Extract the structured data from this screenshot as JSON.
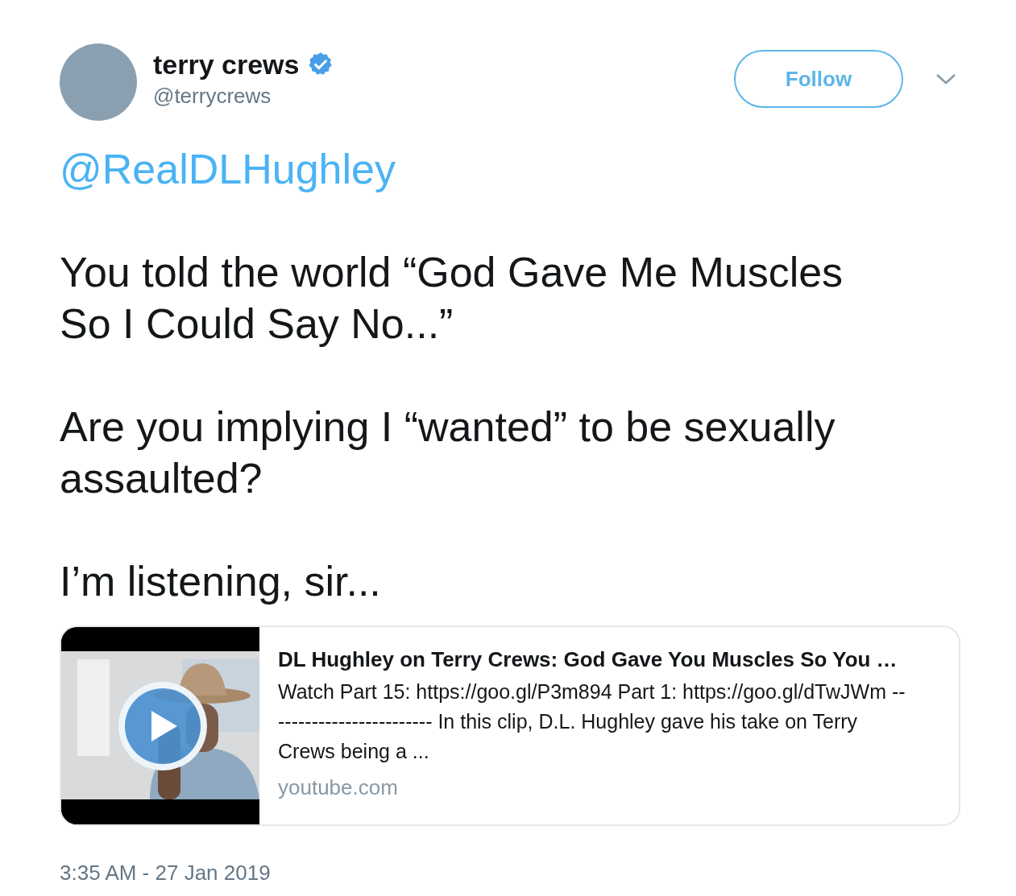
{
  "author": {
    "name": "terry crews",
    "verified": true,
    "handle": "@terrycrews"
  },
  "follow_button": {
    "label": "Follow"
  },
  "tweet": {
    "mention": "@RealDLHughley",
    "paragraphs": [
      "You told the world “God Gave Me Muscles So I Could Say No...”",
      "Are you implying I “wanted” to be sexually assaulted?",
      "I’m listening, sir..."
    ]
  },
  "card": {
    "title": "DL Hughley on Terry Crews: God Gave You Muscles So You …",
    "description": "Watch Part 15: https://goo.gl/P3m894 Part 1: https://goo.gl/dTwJWm ------------------------- In this clip, D.L. Hughley gave his take on Terry Crews being a ...",
    "domain": "youtube.com"
  },
  "timestamp": "3:35 AM - 27 Jan 2019"
}
